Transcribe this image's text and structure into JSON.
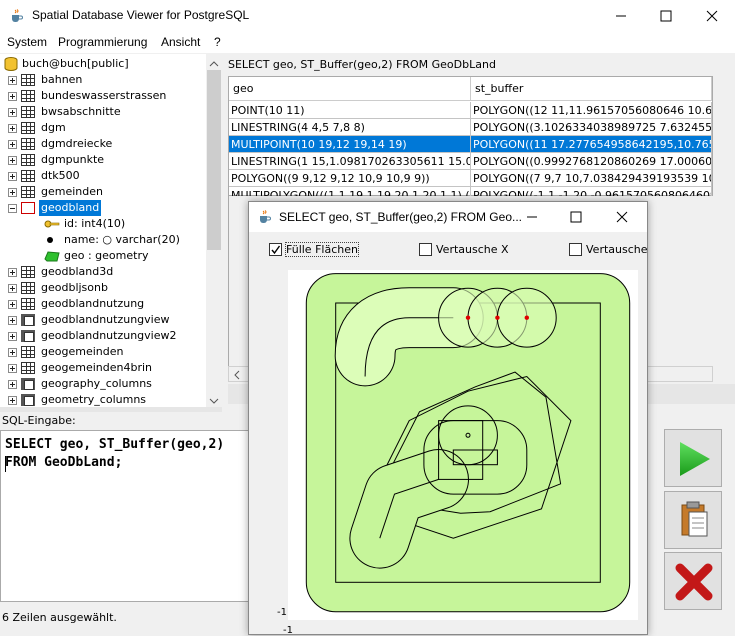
{
  "window": {
    "title": "Spatial Database Viewer for PostgreSQL",
    "icon": "java-cup-icon"
  },
  "menu": [
    "System",
    "Programmierung",
    "Ansicht",
    "?"
  ],
  "tree": {
    "root": "buch@buch[public]",
    "tables": [
      "bahnen",
      "bundeswasserstrassen",
      "bwsabschnitte",
      "dgm",
      "dgmdreiecke",
      "dgmpunkte",
      "dtk500",
      "gemeinden"
    ],
    "selected_table": "geodbland",
    "columns": [
      {
        "label": "id: int4(10)",
        "icon": "key-icon"
      },
      {
        "label": "name: ○ varchar(20)",
        "icon": "dot-icon"
      },
      {
        "label": "geo : geometry",
        "icon": "geometry-icon"
      }
    ],
    "more_tables": [
      {
        "label": "geodbland3d",
        "icon": "table-icon"
      },
      {
        "label": "geodbljsonb",
        "icon": "table-icon"
      },
      {
        "label": "geodblandnutzung",
        "icon": "table-icon"
      },
      {
        "label": "geodblandnutzungview",
        "icon": "view-icon"
      },
      {
        "label": "geodblandnutzungview2",
        "icon": "view-icon"
      },
      {
        "label": "geogemeinden",
        "icon": "table-icon"
      },
      {
        "label": "geogemeinden4brin",
        "icon": "table-icon"
      },
      {
        "label": "geography_columns",
        "icon": "view-icon"
      },
      {
        "label": "geometry_columns",
        "icon": "view-icon"
      }
    ]
  },
  "query": {
    "label": "SELECT geo, ST_Buffer(geo,2) FROM GeoDbLand",
    "columns": [
      "geo",
      "st_buffer"
    ],
    "rows": [
      [
        "POINT(10 11)",
        "POLYGON((12 11,11.96157056080646 10.609..."
      ],
      [
        "LINESTRING(4 4,5 7,8 8)",
        "POLYGON((3.1026334038989725 7.63245553..."
      ],
      [
        "MULTIPOINT(10 19,12 19,14 19)",
        "POLYGON((11 17.277654958642195,10.76536..."
      ],
      [
        "LINESTRING(1 15,1.098170263305611 15.002...",
        "POLYGON((0.9992768120860269 17.0006025..."
      ],
      [
        "POLYGON((9 9,12 9,12 10,9 10,9 9))",
        "POLYGON((7 9,7 10,7.038429439193539 10.3..."
      ],
      [
        "MULTIPOLYGON(((1 1,19 1,19 20,1 20,1 1),(4 ...",
        "POLYGON((-1 1,-1 20,-0.9615705608064609 2..."
      ]
    ],
    "selected_row": 2
  },
  "sql": {
    "label": "SQL-Eingabe:",
    "lines": [
      "SELECT geo, ST_Buffer(geo,2)",
      "FROM GeoDbLand;"
    ]
  },
  "status": "6 Zeilen ausgewählt.",
  "buttons": {
    "run": "play-icon",
    "paste": "clipboard-icon",
    "delete": "delete-x-icon"
  },
  "dialog": {
    "title": "SELECT geo, ST_Buffer(geo,2) FROM Geo...",
    "checkboxes": [
      {
        "label": "Fülle Flächen",
        "checked": true
      },
      {
        "label": "Vertausche X",
        "checked": false
      },
      {
        "label": "Vertausche Y",
        "checked": false
      }
    ],
    "axis_y": "-1",
    "axis_x": "-1",
    "colors": {
      "fill": "#c6f59a",
      "fill_light": "#dcfdb8",
      "stroke": "#000000",
      "point": "#e00000"
    }
  }
}
